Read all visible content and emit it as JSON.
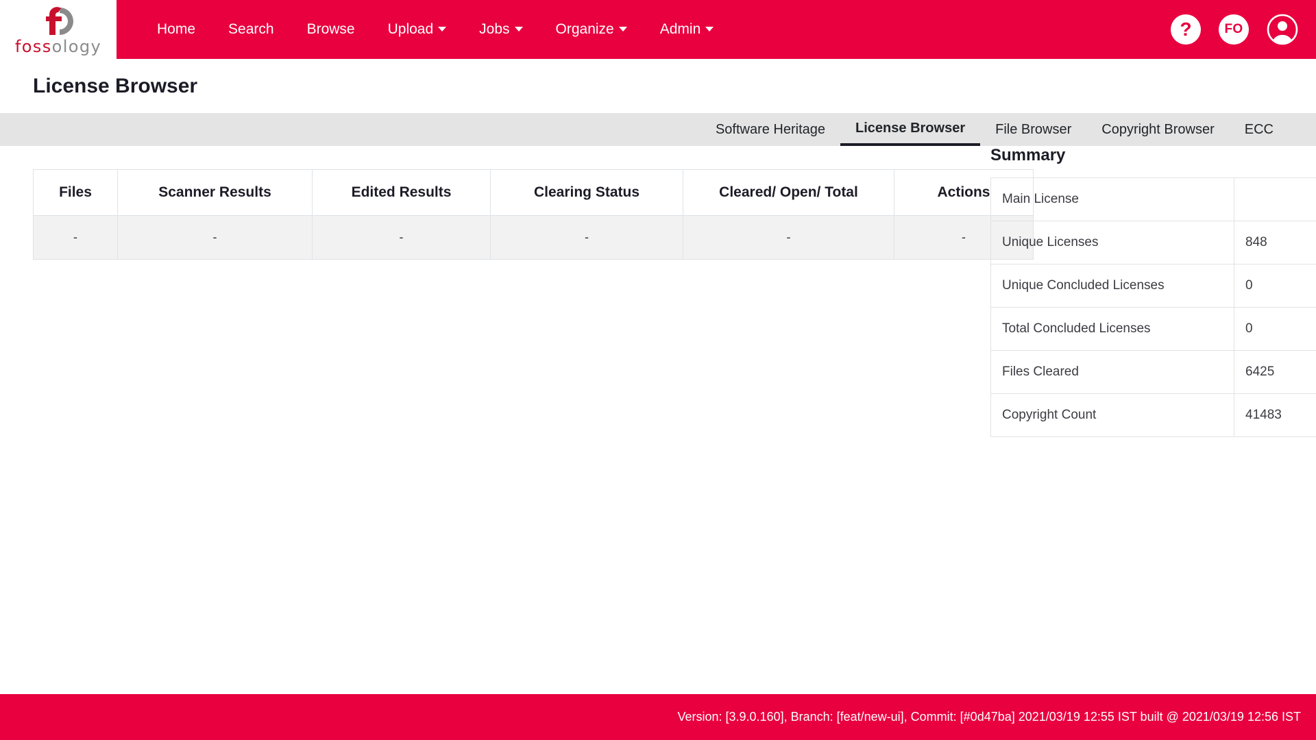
{
  "brand": {
    "wordmark_red": "foss",
    "wordmark_gray": "ology",
    "logo_icon": "fossology-logo-icon"
  },
  "nav": {
    "items": [
      {
        "label": "Home",
        "has_caret": false
      },
      {
        "label": "Search",
        "has_caret": false
      },
      {
        "label": "Browse",
        "has_caret": false
      },
      {
        "label": "Upload",
        "has_caret": true
      },
      {
        "label": "Jobs",
        "has_caret": true
      },
      {
        "label": "Organize",
        "has_caret": true
      },
      {
        "label": "Admin",
        "has_caret": true
      }
    ],
    "help_label": "?",
    "user_initials": "FO",
    "avatar_icon": "user-avatar-icon"
  },
  "header": {
    "title": "License Browser"
  },
  "tabs": [
    {
      "label": "Software Heritage",
      "active": false
    },
    {
      "label": "License Browser",
      "active": true
    },
    {
      "label": "File Browser",
      "active": false
    },
    {
      "label": "Copyright Browser",
      "active": false
    },
    {
      "label": "ECC",
      "active": false
    }
  ],
  "results_table": {
    "columns": [
      "Files",
      "Scanner Results",
      "Edited Results",
      "Clearing Status",
      "Cleared/ Open/ Total",
      "Actions"
    ],
    "rows": [
      [
        "-",
        "-",
        "-",
        "-",
        "-",
        "-"
      ]
    ]
  },
  "summary": {
    "heading": "Summary",
    "rows": [
      {
        "label": "Main License",
        "value": ""
      },
      {
        "label": "Unique Licenses",
        "value": "848"
      },
      {
        "label": "Unique Concluded Licenses",
        "value": "0"
      },
      {
        "label": "Total Concluded Licenses",
        "value": "0"
      },
      {
        "label": "Files Cleared",
        "value": "6425"
      },
      {
        "label": "Copyright Count",
        "value": "41483"
      }
    ]
  },
  "footer": {
    "text": "Version: [3.9.0.160], Branch: [feat/new-ui], Commit: [#0d47ba] 2021/03/19 12:55 IST built @ 2021/03/19 12:56 IST"
  },
  "colors": {
    "brand_red": "#e8003f",
    "logo_red": "#c8102e",
    "logo_gray": "#8b8b8b",
    "tabbar_bg": "#e4e4e4",
    "row_bg": "#f2f2f2"
  }
}
